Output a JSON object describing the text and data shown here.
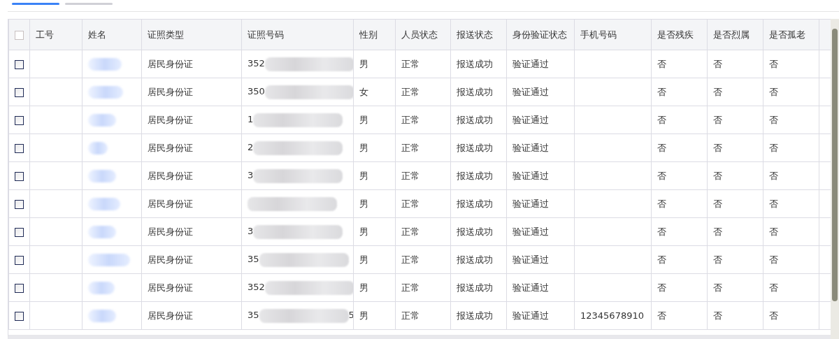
{
  "tabs": [
    {
      "selected": true
    },
    {
      "selected": false
    }
  ],
  "table": {
    "select_all": {
      "checked": false
    },
    "columns": [
      "工号",
      "姓名",
      "证照类型",
      "证照号码",
      "性别",
      "人员状态",
      "报送状态",
      "身份验证状态",
      "手机号码",
      "是否残疾",
      "是否烈属",
      "是否孤老"
    ],
    "rows": [
      {
        "checked": false,
        "id_type": "居民身份证",
        "id_prefix": "352",
        "id_suffix": "",
        "gender": "男",
        "person_status": "正常",
        "report_status": "报送成功",
        "verify_status": "验证通过",
        "phone": "",
        "disabled": "否",
        "martyr": "否",
        "elderly": "否"
      },
      {
        "checked": false,
        "id_type": "居民身份证",
        "id_prefix": "350",
        "id_suffix": "",
        "gender": "女",
        "person_status": "正常",
        "report_status": "报送成功",
        "verify_status": "验证通过",
        "phone": "",
        "disabled": "否",
        "martyr": "否",
        "elderly": "否"
      },
      {
        "checked": false,
        "id_type": "居民身份证",
        "id_prefix": "1",
        "id_suffix": "",
        "gender": "男",
        "person_status": "正常",
        "report_status": "报送成功",
        "verify_status": "验证通过",
        "phone": "",
        "disabled": "否",
        "martyr": "否",
        "elderly": "否"
      },
      {
        "checked": false,
        "id_type": "居民身份证",
        "id_prefix": "2",
        "id_suffix": "",
        "gender": "男",
        "person_status": "正常",
        "report_status": "报送成功",
        "verify_status": "验证通过",
        "phone": "",
        "disabled": "否",
        "martyr": "否",
        "elderly": "否"
      },
      {
        "checked": false,
        "id_type": "居民身份证",
        "id_prefix": "3",
        "id_suffix": "",
        "gender": "男",
        "person_status": "正常",
        "report_status": "报送成功",
        "verify_status": "验证通过",
        "phone": "",
        "disabled": "否",
        "martyr": "否",
        "elderly": "否"
      },
      {
        "checked": false,
        "id_type": "居民身份证",
        "id_prefix": "",
        "id_suffix": "",
        "gender": "男",
        "person_status": "正常",
        "report_status": "报送成功",
        "verify_status": "验证通过",
        "phone": "",
        "disabled": "否",
        "martyr": "否",
        "elderly": "否"
      },
      {
        "checked": false,
        "id_type": "居民身份证",
        "id_prefix": "3",
        "id_suffix": "",
        "gender": "男",
        "person_status": "正常",
        "report_status": "报送成功",
        "verify_status": "验证通过",
        "phone": "",
        "disabled": "否",
        "martyr": "否",
        "elderly": "否"
      },
      {
        "checked": false,
        "id_type": "居民身份证",
        "id_prefix": "35",
        "id_suffix": "",
        "gender": "男",
        "person_status": "正常",
        "report_status": "报送成功",
        "verify_status": "验证通过",
        "phone": "",
        "disabled": "否",
        "martyr": "否",
        "elderly": "否"
      },
      {
        "checked": false,
        "id_type": "居民身份证",
        "id_prefix": "352",
        "id_suffix": "",
        "gender": "男",
        "person_status": "正常",
        "report_status": "报送成功",
        "verify_status": "验证通过",
        "phone": "",
        "disabled": "否",
        "martyr": "否",
        "elderly": "否"
      },
      {
        "checked": false,
        "id_type": "居民身份证",
        "id_prefix": "35",
        "id_suffix": "5",
        "gender": "男",
        "person_status": "正常",
        "report_status": "报送成功",
        "verify_status": "验证通过",
        "phone": "12345678910",
        "disabled": "否",
        "martyr": "否",
        "elderly": "否"
      }
    ]
  }
}
